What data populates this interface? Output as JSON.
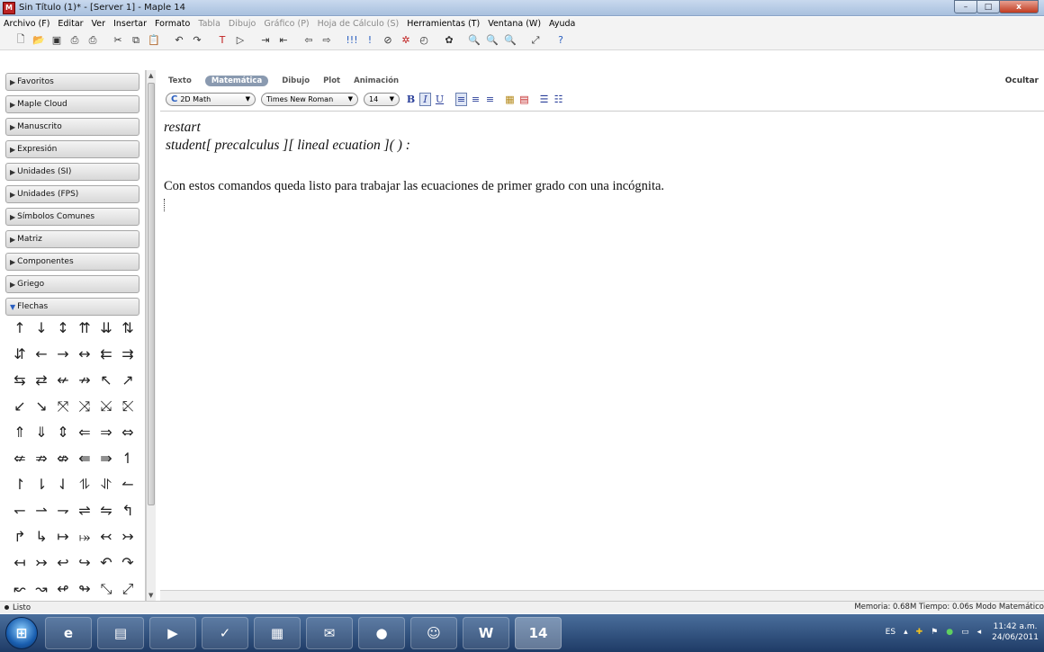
{
  "window": {
    "title": "Sin Título (1)* - [Server 1] - Maple 14",
    "app_icon": "maple-icon",
    "controls": {
      "minimize": "–",
      "maximize": "□",
      "close": "x"
    }
  },
  "menu": [
    "Archivo (F)",
    "Editar",
    "Ver",
    "Insertar",
    "Formato",
    "Tabla",
    "Dibujo",
    "Gráfico (P)",
    "Hoja de Cálculo (S)",
    "Herramientas (T)",
    "Ventana (W)",
    "Ayuda"
  ],
  "menu_disabled": [
    false,
    false,
    false,
    false,
    false,
    true,
    true,
    true,
    true,
    false,
    false,
    false
  ],
  "toolbar_icons": [
    {
      "name": "new-icon",
      "glyph": "🗋",
      "tone": ""
    },
    {
      "name": "open-icon",
      "glyph": "📂",
      "tone": ""
    },
    {
      "name": "save-icon",
      "glyph": "▣",
      "tone": ""
    },
    {
      "name": "print-icon",
      "glyph": "⎙",
      "tone": ""
    },
    {
      "name": "print-preview-icon",
      "glyph": "⎙",
      "tone": ""
    },
    {
      "name": "cut-icon",
      "glyph": "✂",
      "tone": "sep"
    },
    {
      "name": "copy-icon",
      "glyph": "⧉",
      "tone": ""
    },
    {
      "name": "paste-icon",
      "glyph": "📋",
      "tone": ""
    },
    {
      "name": "undo-icon",
      "glyph": "↶",
      "tone": "sep"
    },
    {
      "name": "redo-icon",
      "glyph": "↷",
      "tone": ""
    },
    {
      "name": "text-mode-icon",
      "glyph": "T",
      "tone": "sep red"
    },
    {
      "name": "execution-group-icon",
      "glyph": "▷",
      "tone": ""
    },
    {
      "name": "indent-icon",
      "glyph": "⇥",
      "tone": "sep"
    },
    {
      "name": "outdent-icon",
      "glyph": "⇤",
      "tone": ""
    },
    {
      "name": "back-icon",
      "glyph": "⇦",
      "tone": "sep"
    },
    {
      "name": "forward-icon",
      "glyph": "⇨",
      "tone": ""
    },
    {
      "name": "execute-all-icon",
      "glyph": "!!!",
      "tone": "sep blue"
    },
    {
      "name": "execute-icon",
      "glyph": "!",
      "tone": "blue"
    },
    {
      "name": "stop-icon",
      "glyph": "⊘",
      "tone": ""
    },
    {
      "name": "debug-icon",
      "glyph": "✲",
      "tone": "red"
    },
    {
      "name": "restart-icon",
      "glyph": "◴",
      "tone": ""
    },
    {
      "name": "tools-icon",
      "glyph": "✿",
      "tone": "sep"
    },
    {
      "name": "zoom-100-icon",
      "glyph": "🔍",
      "tone": "sep blue"
    },
    {
      "name": "zoom-in-icon",
      "glyph": "🔍",
      "tone": "blue"
    },
    {
      "name": "zoom-out-icon",
      "glyph": "🔍",
      "tone": "blue"
    },
    {
      "name": "expand-icon",
      "glyph": "⤢",
      "tone": "sep"
    },
    {
      "name": "help-icon",
      "glyph": "?",
      "tone": "sep blue"
    }
  ],
  "palettes": [
    {
      "label": "Favoritos",
      "open": false
    },
    {
      "label": "Maple Cloud",
      "open": false
    },
    {
      "label": "Manuscrito",
      "open": false
    },
    {
      "label": "Expresión",
      "open": false
    },
    {
      "label": "Unidades (SI)",
      "open": false
    },
    {
      "label": "Unidades (FPS)",
      "open": false
    },
    {
      "label": "Símbolos Comunes",
      "open": false
    },
    {
      "label": "Matriz",
      "open": false
    },
    {
      "label": "Componentes",
      "open": false
    },
    {
      "label": "Griego",
      "open": false
    },
    {
      "label": "Flechas",
      "open": true
    }
  ],
  "arrows": [
    "↑",
    "↓",
    "↕",
    "⇈",
    "⇊",
    "⇅",
    "⇵",
    "←",
    "→",
    "↔",
    "⇇",
    "⇉",
    "⇆",
    "⇄",
    "↚",
    "↛",
    "↖",
    "↗",
    "↙",
    "↘",
    "⤧",
    "⤨",
    "⤩",
    "⤪",
    "⇑",
    "⇓",
    "⇕",
    "⇐",
    "⇒",
    "⇔",
    "⇍",
    "⇏",
    "⇎",
    "⇚",
    "⇛",
    "↿",
    "↾",
    "⇂",
    "⇃",
    "⥮",
    "⥯",
    "↼",
    "↽",
    "⇀",
    "⇁",
    "⇌",
    "⇋",
    "↰",
    "↱",
    "↳",
    "↦",
    "⤅",
    "↢",
    "↣",
    "↤",
    "↣",
    "↩",
    "↪",
    "↶",
    "↷",
    "↜",
    "↝",
    "↫",
    "↬",
    "⤡",
    "⤢",
    "↜",
    "↭",
    "↯",
    "⇜"
  ],
  "format_tabs": {
    "items": [
      "Texto",
      "Matemática",
      "Dibujo",
      "Plot",
      "Animación"
    ],
    "active": "Matemática",
    "hide": "Ocultar"
  },
  "format_bar": {
    "mode": "2D Math",
    "font": "Times New Roman",
    "size": "14",
    "bold": "B",
    "italic": "I",
    "underline": "U"
  },
  "document": {
    "line1": "restart",
    "line2": "student[ precalculus ][ lineal ecuation ]( ) :",
    "line3": "Con estos comandos queda listo para trabajar las ecuaciones de primer grado con una incógnita."
  },
  "status": {
    "left": "Listo",
    "right": "Memoria: 0.68M   Tiempo: 0.06s   Modo Matemático"
  },
  "taskbar": {
    "apps": [
      "ie-icon",
      "explorer-icon",
      "media-icon",
      "task-icon",
      "office-icon",
      "messenger-icon",
      "player-icon",
      "users-icon",
      "word-icon",
      "maple-icon"
    ],
    "apps_glyphs": [
      "e",
      "▤",
      "▶",
      "✓",
      "▦",
      "✉",
      "●",
      "☺",
      "W",
      "14"
    ],
    "lang": "ES",
    "time": "11:42 a.m.",
    "date": "24/06/2011"
  }
}
